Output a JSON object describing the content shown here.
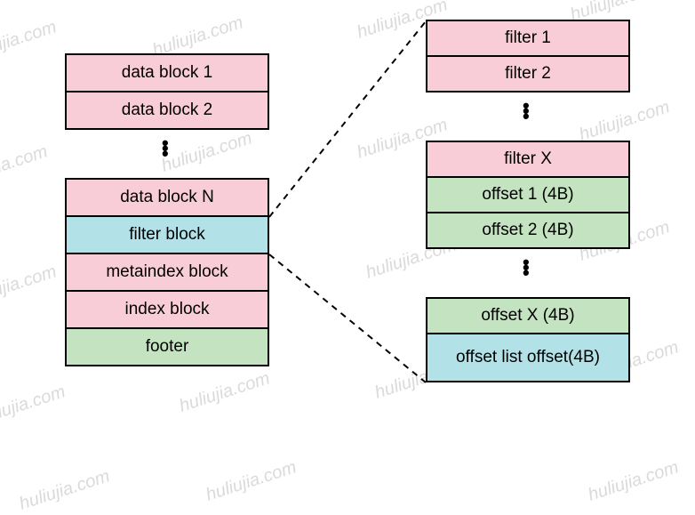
{
  "left_stack": {
    "data_block_1": "data block 1",
    "data_block_2": "data block 2",
    "data_block_n": "data block N",
    "filter_block": "filter block",
    "metaindex_block": "metaindex block",
    "index_block": "index block",
    "footer": "footer"
  },
  "right_stack": {
    "filter_1": "filter 1",
    "filter_2": "filter 2",
    "filter_x": "filter X",
    "offset_1": "offset 1 (4B)",
    "offset_2": "offset 2 (4B)",
    "offset_x": "offset X (4B)",
    "offset_list_offset": "offset list offset(4B)"
  },
  "watermark_text": "huliujia.com",
  "colors": {
    "pink": "#f8cdd7",
    "cyan": "#b2e2e8",
    "green": "#c4e3c0"
  }
}
